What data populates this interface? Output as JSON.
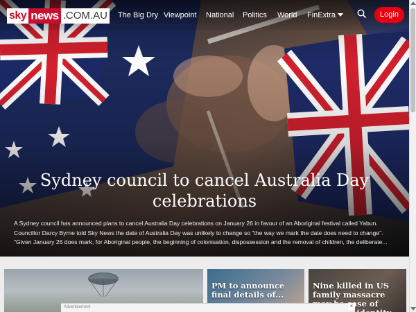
{
  "nav": {
    "logo": {
      "sky": "sky",
      "news": "news",
      "domain": ".COM.AU"
    },
    "links": [
      "The Big Dry",
      "Viewpoint",
      "National",
      "Politics",
      "World"
    ],
    "more_label": "FinExtra",
    "login_label": "Login",
    "accent_color": "#e60012"
  },
  "hero": {
    "headline": "Sydney council to cancel Australia Day celebrations",
    "summary": [
      "A Sydney council has announced plans to cancel Australia Day celebrations on January 26 in favour of an Aboriginal festival called Yabun.",
      "Councillor Darcy Byrne told Sky News the date of Australia Day was unlikely to change so \"the way we mark the date does need to change\".",
      "\"Given January 26 does mark, for Aboriginal people, the beginning of colonisation, dispossession and the removal of children, the deliberate..."
    ]
  },
  "cards": [
    {
      "title": ""
    },
    {
      "title": "PM to announce final details of..."
    },
    {
      "title": "Nine killed in US family massacre may be case of mistaken identity"
    }
  ],
  "ad": {
    "label": "Advertisement",
    "close": "×"
  }
}
